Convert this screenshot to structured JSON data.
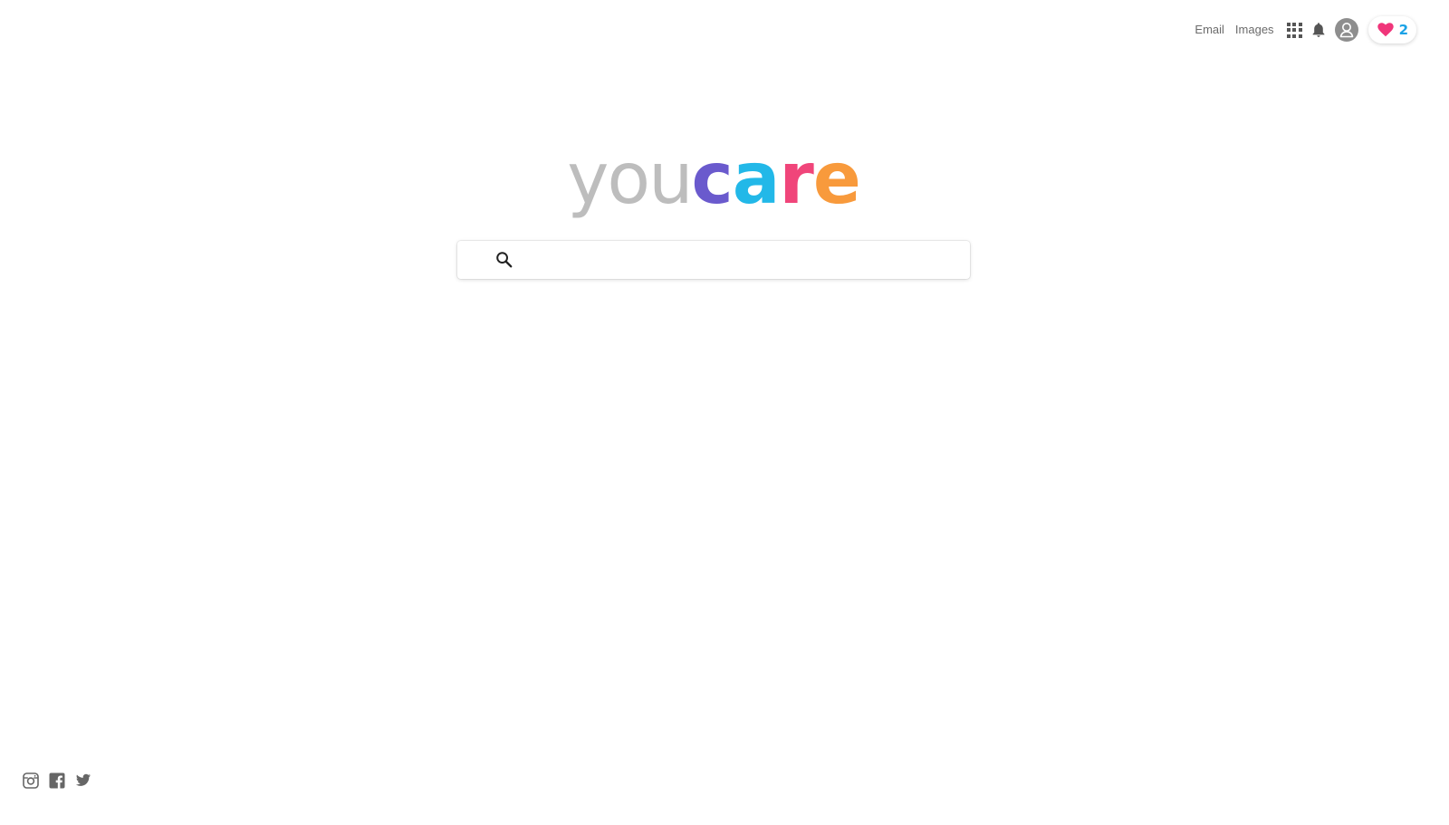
{
  "header": {
    "email_label": "Email",
    "images_label": "Images",
    "hearts_count": "2",
    "icons": [
      "apps-grid-icon",
      "bell-icon",
      "user-avatar-icon",
      "heart-icon",
      "hamburger-menu-icon"
    ]
  },
  "logo": {
    "part1": "you",
    "letters": [
      {
        "char": "c",
        "color": "#6a5acd"
      },
      {
        "char": "a",
        "color": "#22b8e8"
      },
      {
        "char": "r",
        "color": "#f0457a"
      },
      {
        "char": "e",
        "color": "#f89a3c"
      }
    ]
  },
  "search": {
    "value": "",
    "placeholder": ""
  },
  "footer": {
    "social_icons": [
      "instagram-icon",
      "facebook-icon",
      "twitter-icon"
    ]
  },
  "colors": {
    "link_text": "#6b6b6b",
    "icon_gray": "#555555",
    "heart": "#f0357a",
    "hearts_count": "#1aa2e6",
    "logo_gray": "#bdbdbd"
  }
}
